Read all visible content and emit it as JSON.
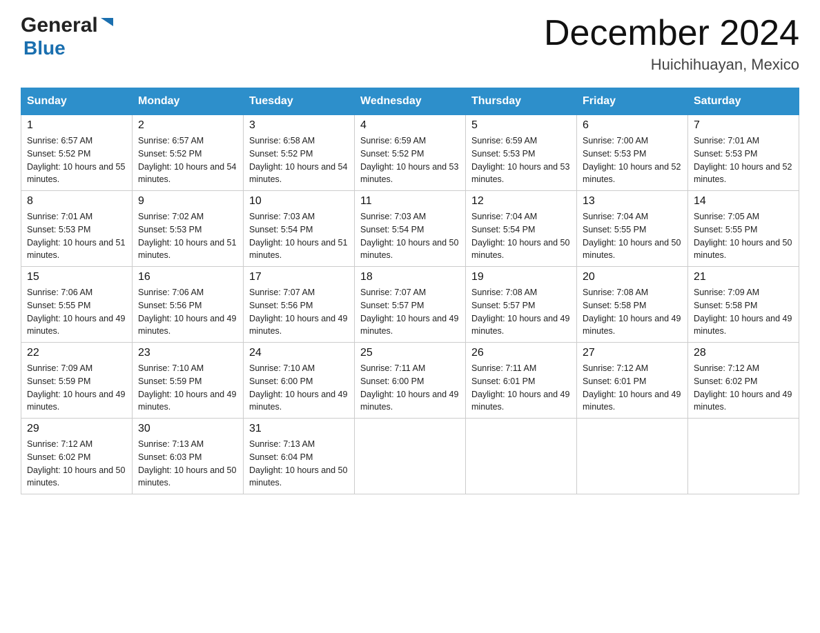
{
  "header": {
    "logo_general": "General",
    "logo_blue": "Blue",
    "month_title": "December 2024",
    "location": "Huichihuayan, Mexico"
  },
  "columns": [
    "Sunday",
    "Monday",
    "Tuesday",
    "Wednesday",
    "Thursday",
    "Friday",
    "Saturday"
  ],
  "weeks": [
    [
      {
        "day": "1",
        "sunrise": "6:57 AM",
        "sunset": "5:52 PM",
        "daylight": "10 hours and 55 minutes."
      },
      {
        "day": "2",
        "sunrise": "6:57 AM",
        "sunset": "5:52 PM",
        "daylight": "10 hours and 54 minutes."
      },
      {
        "day": "3",
        "sunrise": "6:58 AM",
        "sunset": "5:52 PM",
        "daylight": "10 hours and 54 minutes."
      },
      {
        "day": "4",
        "sunrise": "6:59 AM",
        "sunset": "5:52 PM",
        "daylight": "10 hours and 53 minutes."
      },
      {
        "day": "5",
        "sunrise": "6:59 AM",
        "sunset": "5:53 PM",
        "daylight": "10 hours and 53 minutes."
      },
      {
        "day": "6",
        "sunrise": "7:00 AM",
        "sunset": "5:53 PM",
        "daylight": "10 hours and 52 minutes."
      },
      {
        "day": "7",
        "sunrise": "7:01 AM",
        "sunset": "5:53 PM",
        "daylight": "10 hours and 52 minutes."
      }
    ],
    [
      {
        "day": "8",
        "sunrise": "7:01 AM",
        "sunset": "5:53 PM",
        "daylight": "10 hours and 51 minutes."
      },
      {
        "day": "9",
        "sunrise": "7:02 AM",
        "sunset": "5:53 PM",
        "daylight": "10 hours and 51 minutes."
      },
      {
        "day": "10",
        "sunrise": "7:03 AM",
        "sunset": "5:54 PM",
        "daylight": "10 hours and 51 minutes."
      },
      {
        "day": "11",
        "sunrise": "7:03 AM",
        "sunset": "5:54 PM",
        "daylight": "10 hours and 50 minutes."
      },
      {
        "day": "12",
        "sunrise": "7:04 AM",
        "sunset": "5:54 PM",
        "daylight": "10 hours and 50 minutes."
      },
      {
        "day": "13",
        "sunrise": "7:04 AM",
        "sunset": "5:55 PM",
        "daylight": "10 hours and 50 minutes."
      },
      {
        "day": "14",
        "sunrise": "7:05 AM",
        "sunset": "5:55 PM",
        "daylight": "10 hours and 50 minutes."
      }
    ],
    [
      {
        "day": "15",
        "sunrise": "7:06 AM",
        "sunset": "5:55 PM",
        "daylight": "10 hours and 49 minutes."
      },
      {
        "day": "16",
        "sunrise": "7:06 AM",
        "sunset": "5:56 PM",
        "daylight": "10 hours and 49 minutes."
      },
      {
        "day": "17",
        "sunrise": "7:07 AM",
        "sunset": "5:56 PM",
        "daylight": "10 hours and 49 minutes."
      },
      {
        "day": "18",
        "sunrise": "7:07 AM",
        "sunset": "5:57 PM",
        "daylight": "10 hours and 49 minutes."
      },
      {
        "day": "19",
        "sunrise": "7:08 AM",
        "sunset": "5:57 PM",
        "daylight": "10 hours and 49 minutes."
      },
      {
        "day": "20",
        "sunrise": "7:08 AM",
        "sunset": "5:58 PM",
        "daylight": "10 hours and 49 minutes."
      },
      {
        "day": "21",
        "sunrise": "7:09 AM",
        "sunset": "5:58 PM",
        "daylight": "10 hours and 49 minutes."
      }
    ],
    [
      {
        "day": "22",
        "sunrise": "7:09 AM",
        "sunset": "5:59 PM",
        "daylight": "10 hours and 49 minutes."
      },
      {
        "day": "23",
        "sunrise": "7:10 AM",
        "sunset": "5:59 PM",
        "daylight": "10 hours and 49 minutes."
      },
      {
        "day": "24",
        "sunrise": "7:10 AM",
        "sunset": "6:00 PM",
        "daylight": "10 hours and 49 minutes."
      },
      {
        "day": "25",
        "sunrise": "7:11 AM",
        "sunset": "6:00 PM",
        "daylight": "10 hours and 49 minutes."
      },
      {
        "day": "26",
        "sunrise": "7:11 AM",
        "sunset": "6:01 PM",
        "daylight": "10 hours and 49 minutes."
      },
      {
        "day": "27",
        "sunrise": "7:12 AM",
        "sunset": "6:01 PM",
        "daylight": "10 hours and 49 minutes."
      },
      {
        "day": "28",
        "sunrise": "7:12 AM",
        "sunset": "6:02 PM",
        "daylight": "10 hours and 49 minutes."
      }
    ],
    [
      {
        "day": "29",
        "sunrise": "7:12 AM",
        "sunset": "6:02 PM",
        "daylight": "10 hours and 50 minutes."
      },
      {
        "day": "30",
        "sunrise": "7:13 AM",
        "sunset": "6:03 PM",
        "daylight": "10 hours and 50 minutes."
      },
      {
        "day": "31",
        "sunrise": "7:13 AM",
        "sunset": "6:04 PM",
        "daylight": "10 hours and 50 minutes."
      },
      {
        "day": "",
        "sunrise": "",
        "sunset": "",
        "daylight": ""
      },
      {
        "day": "",
        "sunrise": "",
        "sunset": "",
        "daylight": ""
      },
      {
        "day": "",
        "sunrise": "",
        "sunset": "",
        "daylight": ""
      },
      {
        "day": "",
        "sunrise": "",
        "sunset": "",
        "daylight": ""
      }
    ]
  ],
  "labels": {
    "sunrise_prefix": "Sunrise: ",
    "sunset_prefix": "Sunset: ",
    "daylight_prefix": "Daylight: "
  }
}
